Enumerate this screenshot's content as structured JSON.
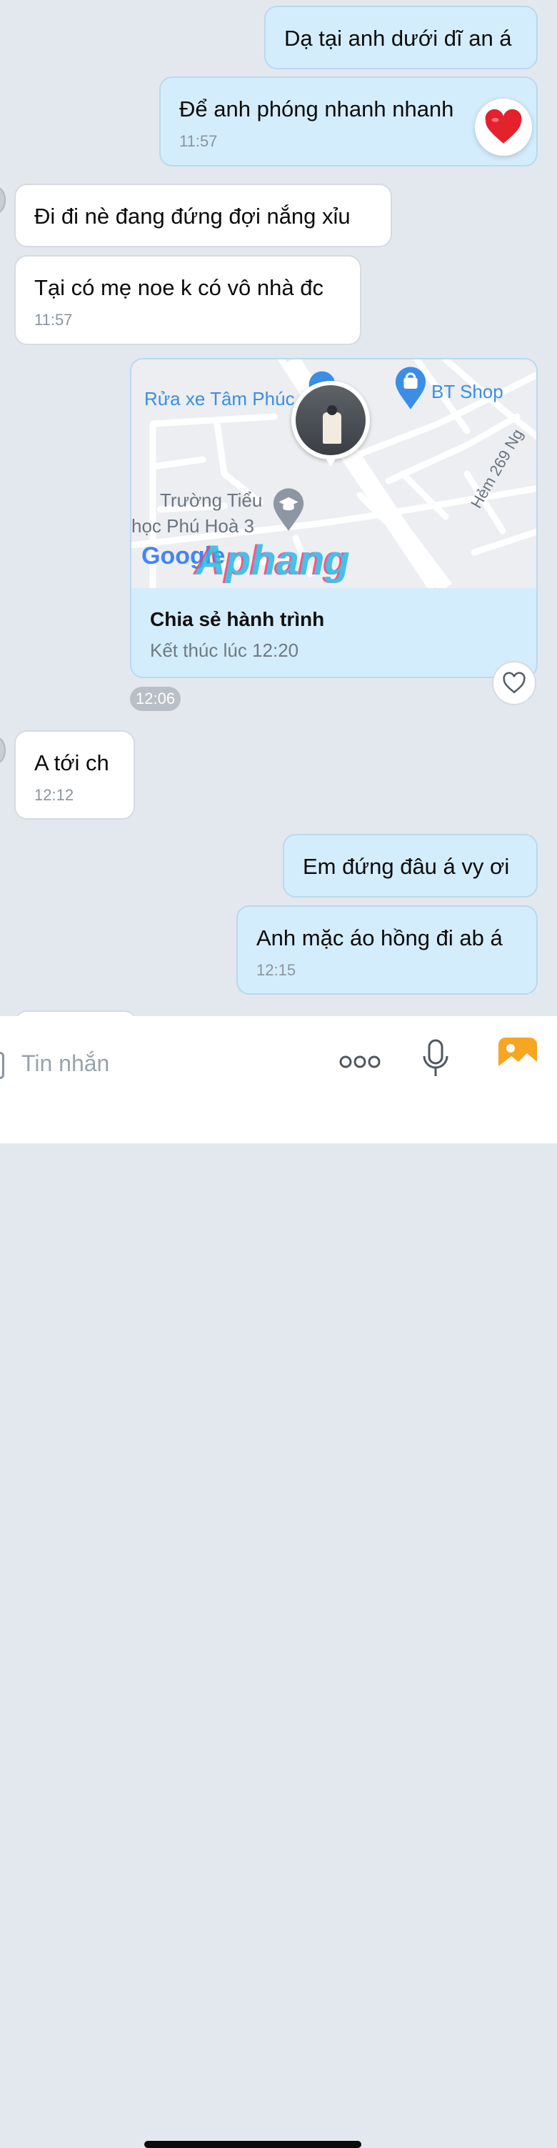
{
  "messages": [
    {
      "text": "Dạ tại anh dưới dĩ an á",
      "time": ""
    },
    {
      "text": "Để anh phóng nhanh nhanh",
      "time": "11:57"
    },
    {
      "text": "Đi đi nè đang đứng đợi nắng xỉu",
      "time": ""
    },
    {
      "text": "Tại có mẹ noe k có vô nhà đc",
      "time": "11:57"
    },
    {
      "text": "A tới ch",
      "time": "12:12"
    },
    {
      "text": "Em đứng đâu á vy ơi",
      "time": ""
    },
    {
      "text": "Anh mặc áo hồng đi ab á",
      "time": "12:15"
    }
  ],
  "location_card": {
    "map_labels": {
      "car_wash": "Rửa xe Tâm Phúc",
      "shop": "BT Shop",
      "school_line1": "Trường Tiểu",
      "school_line2": "học Phú Hoà 3",
      "alley": "Hẻm 269 Ng",
      "google": "Google",
      "watermark": "Aphang"
    },
    "title": "Chia sẻ hành trình",
    "subtitle": "Kết thúc lúc 12:20",
    "time": "12:06"
  },
  "composer": {
    "placeholder": "Tin nhắn",
    "icons": [
      "more-icon",
      "microphone-icon",
      "gallery-icon"
    ]
  },
  "colors": {
    "outgoing_bubble": "#d4edfc",
    "incoming_bubble": "#ffffff",
    "background": "#e3e8ee",
    "map_blue": "#3a8ee6",
    "gallery_orange": "#f5a623"
  }
}
